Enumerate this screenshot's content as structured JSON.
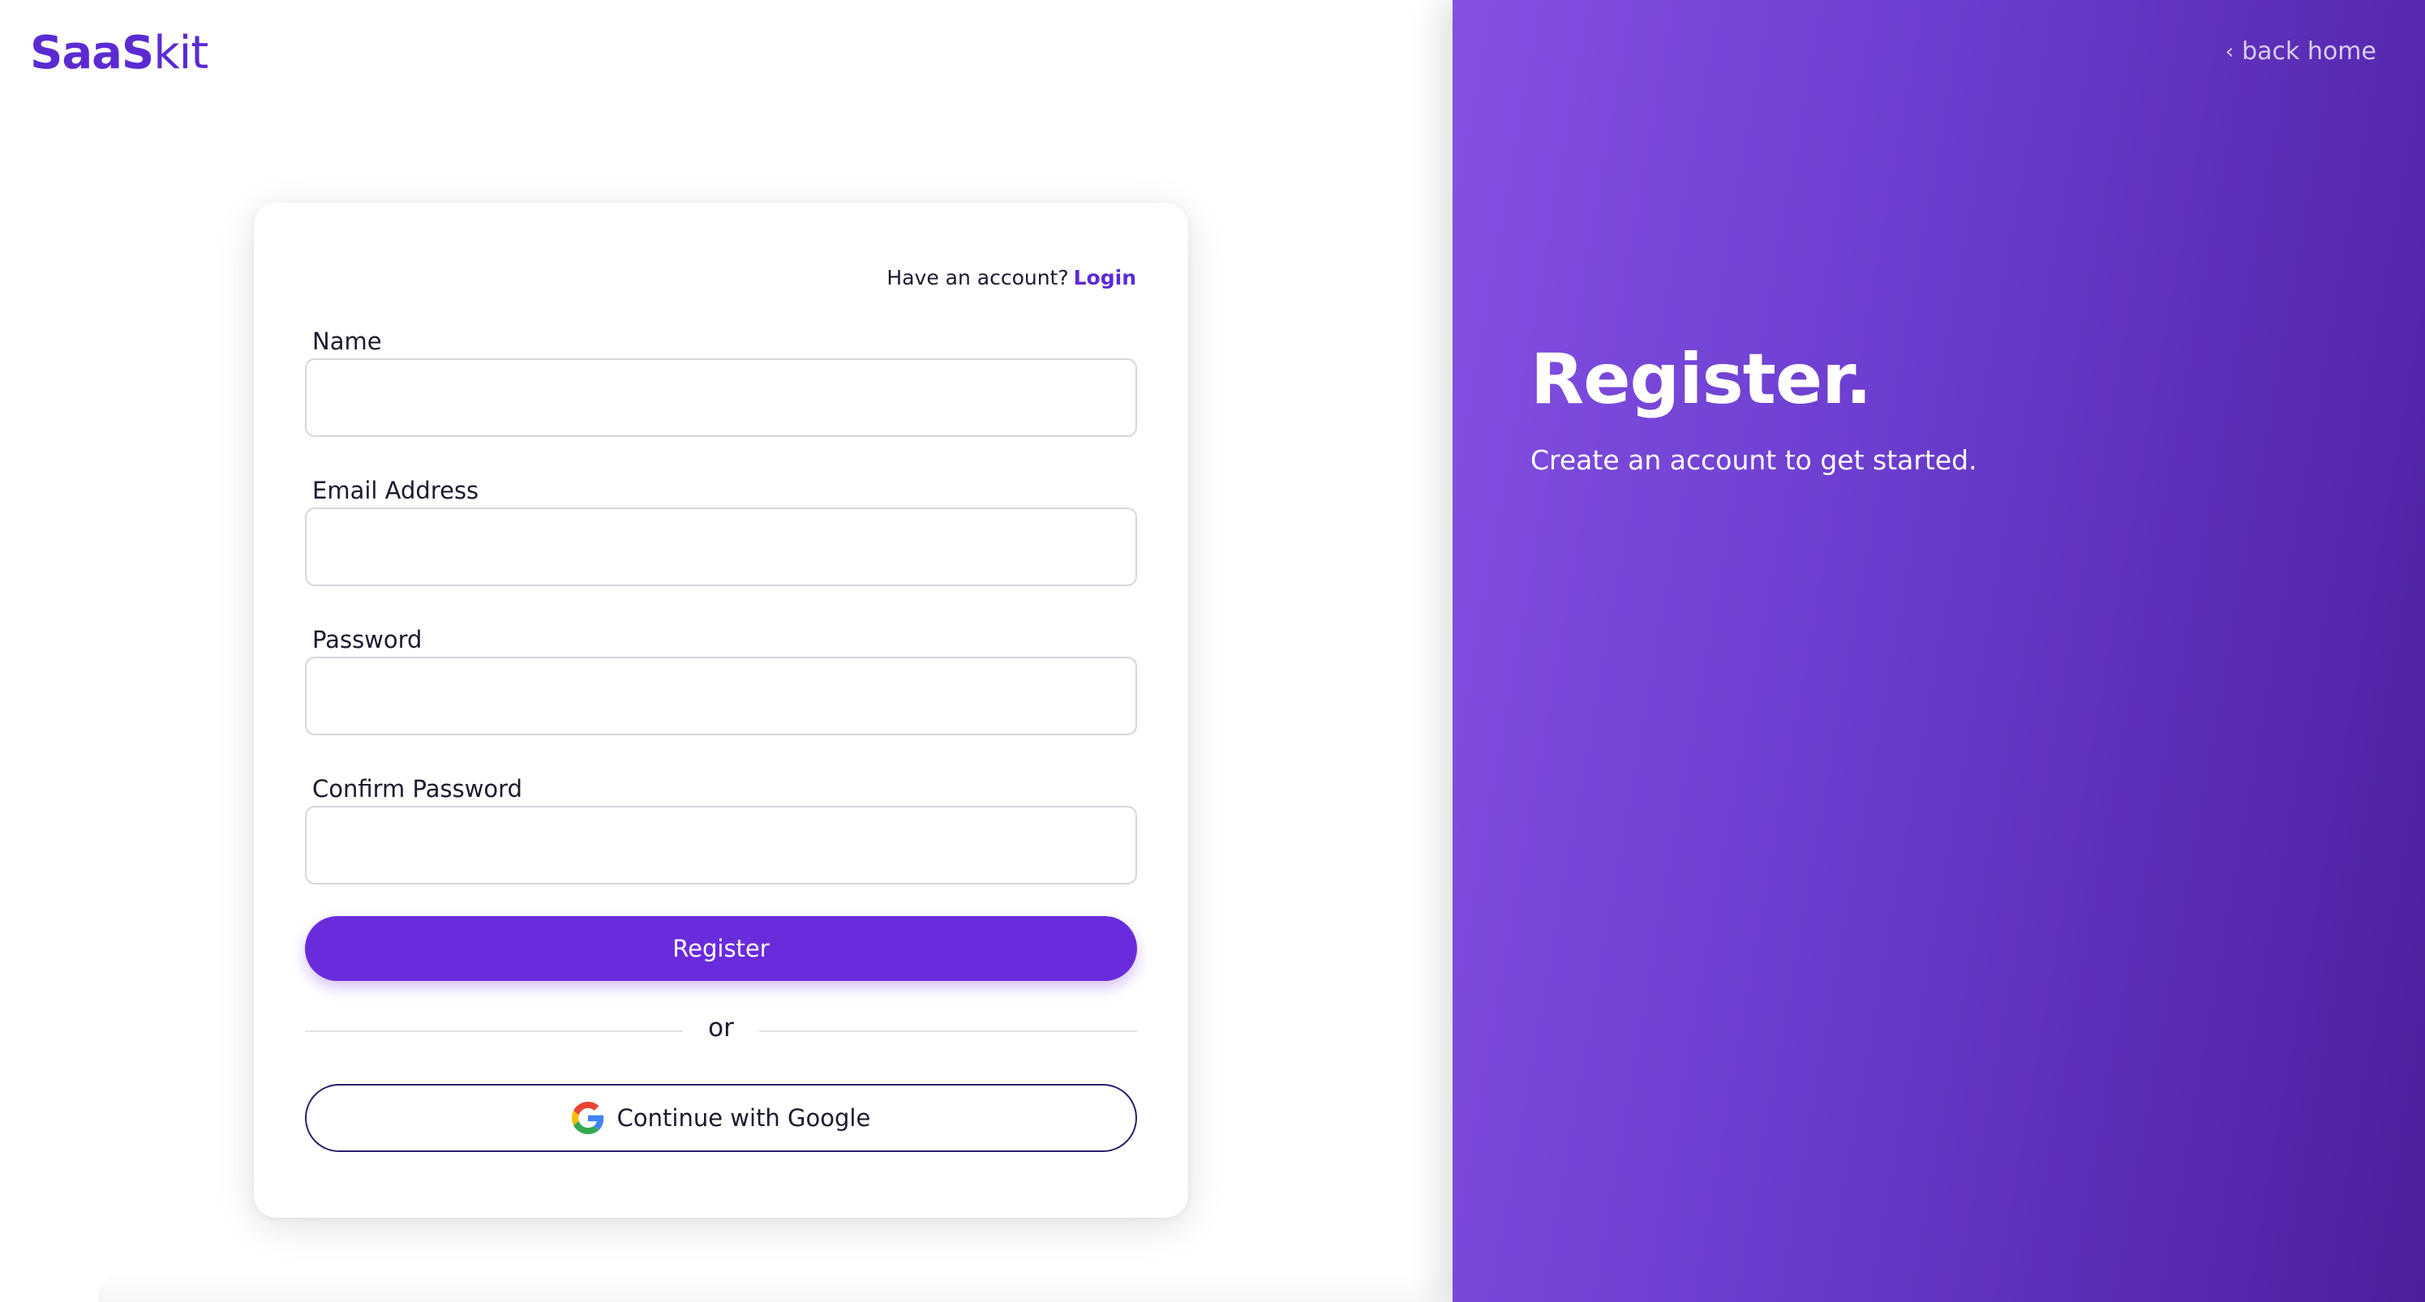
{
  "brand": {
    "logo_bold": "SaaS",
    "logo_light": "kit",
    "accent_color": "#6a2bdc"
  },
  "form": {
    "have_account_text": "Have an account?",
    "login_link": "Login",
    "fields": [
      {
        "label": "Name",
        "value": "",
        "placeholder": ""
      },
      {
        "label": "Email Address",
        "value": "",
        "placeholder": ""
      },
      {
        "label": "Password",
        "value": "",
        "placeholder": ""
      },
      {
        "label": "Confirm Password",
        "value": "",
        "placeholder": ""
      }
    ],
    "register_button": "Register",
    "divider_text": "or",
    "google_button": "Continue with Google",
    "google_icon": "google-logo-icon"
  },
  "hero": {
    "back_home": "back home",
    "back_icon": "chevron-left-icon",
    "title": "Register.",
    "subtitle": "Create an account to get started.",
    "gradient_colors": [
      "#8451e3",
      "#4c1f9e"
    ]
  }
}
